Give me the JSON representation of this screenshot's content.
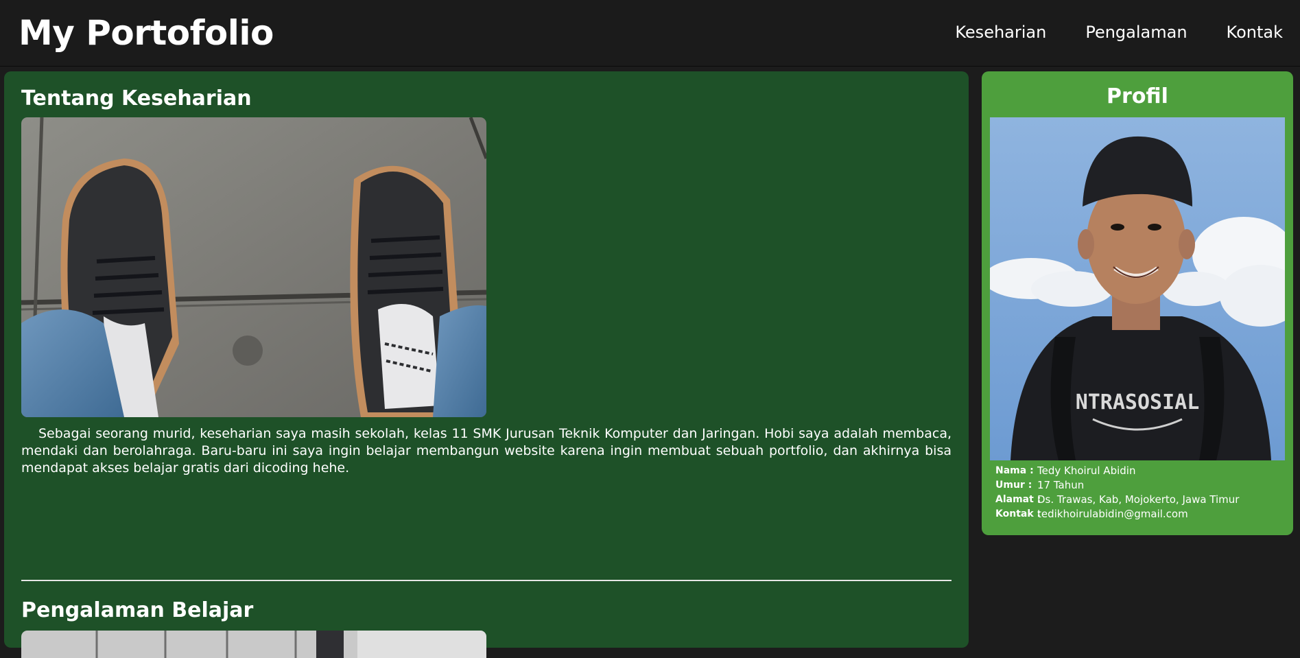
{
  "header": {
    "title": "My Portofolio",
    "nav": [
      "Keseharian",
      "Pengalaman",
      "Kontak"
    ]
  },
  "article": {
    "heading": "Tentang Keseharian",
    "photo_label": "shoes-on-pavement-photo",
    "paragraph": "Sebagai seorang murid, keseharian saya masih sekolah, kelas 11 SMK Jurusan Teknik Komputer dan Jaringan. Hobi saya adalah membaca, mendaki dan berolahraga. Baru-baru ini saya ingin belajar membangun website karena ingin membuat sebuah portfolio, dan akhirnya bisa mendapat akses belajar gratis dari dicoding hehe.",
    "section2_heading": "Pengalaman Belajar"
  },
  "profile": {
    "heading": "Profil",
    "shirt_text": "NTRASOSIAL",
    "fields": [
      {
        "label": "Nama :",
        "value": "Tedy Khoirul Abidin"
      },
      {
        "label": "Umur :",
        "value": "17 Tahun"
      },
      {
        "label": "Alamat :",
        "value": "Ds. Trawas, Kab, Mojokerto, Jawa Timur"
      },
      {
        "label": "Kontak :",
        "value": "tedikhoirulabidin@gmail.com"
      }
    ]
  },
  "colors": {
    "page_bg": "#1c1c1c",
    "header_bg": "#1b1b1b",
    "article_bg": "#1e5128",
    "profile_bg": "#4e9f3d",
    "text": "#ffffff"
  }
}
